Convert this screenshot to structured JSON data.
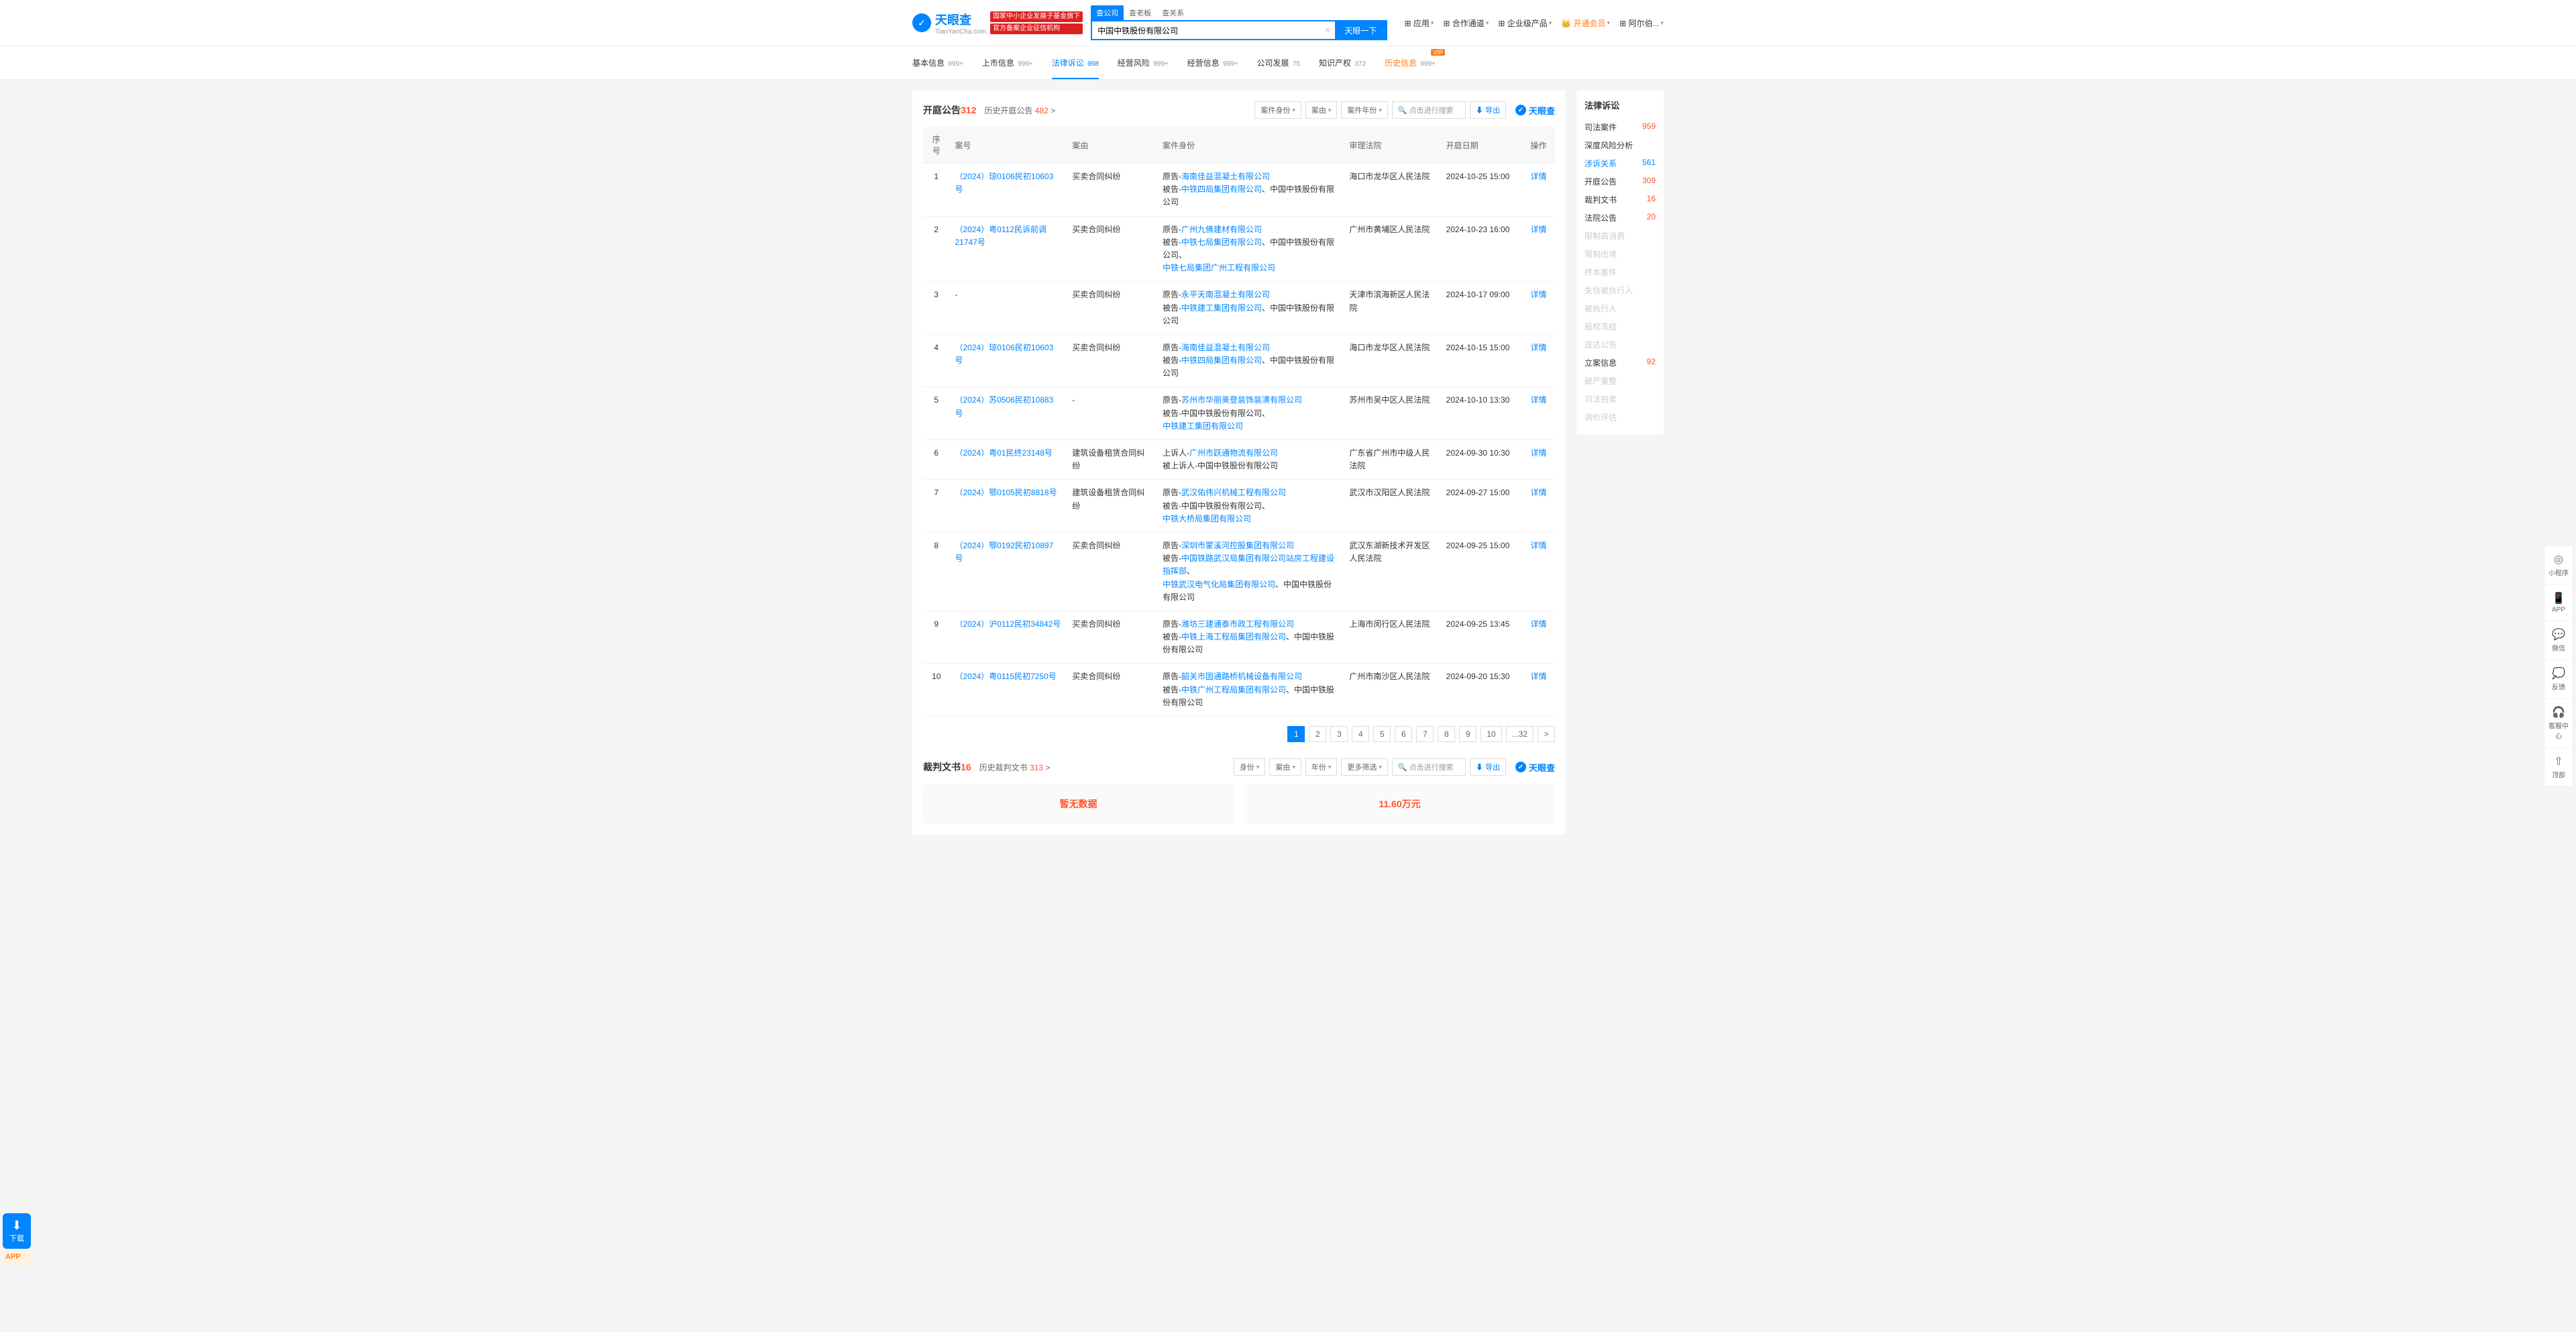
{
  "header": {
    "logo_text": "天眼查",
    "logo_sub": "TianYanCha.com",
    "badge1": "国家中小企业发展子基金旗下",
    "badge2": "官方备案企业征信机构",
    "search_tabs": [
      "查公司",
      "查老板",
      "查关系"
    ],
    "search_value": "中国中铁股份有限公司",
    "search_btn": "天眼一下",
    "nav": [
      {
        "label": "应用",
        "drop": true
      },
      {
        "label": "合作通道",
        "drop": true
      },
      {
        "label": "企业级产品",
        "drop": true
      },
      {
        "label": "开通会员",
        "vip": true,
        "drop": true
      },
      {
        "label": "阿尔伯...",
        "drop": true
      }
    ]
  },
  "cats": [
    {
      "label": "基本信息",
      "count": "999+"
    },
    {
      "label": "上市信息",
      "count": "999+"
    },
    {
      "label": "法律诉讼",
      "count": "998",
      "active": true
    },
    {
      "label": "经营风险",
      "count": "999+"
    },
    {
      "label": "经营信息",
      "count": "999+"
    },
    {
      "label": "公司发展",
      "count": "75"
    },
    {
      "label": "知识产权",
      "count": "372"
    },
    {
      "label": "历史信息",
      "count": "999+",
      "hist": true,
      "badge": "VIP"
    }
  ],
  "section": {
    "title": "开庭公告",
    "count": "312",
    "hist_label": "历史开庭公告",
    "hist_count": "482",
    "filters": [
      "案件身份",
      "案由",
      "案件年份"
    ],
    "search_ph": "点击进行搜索",
    "export": "导出",
    "brand": "天眼查"
  },
  "table": {
    "headers": [
      "序号",
      "案号",
      "案由",
      "案件身份",
      "审理法院",
      "开庭日期",
      "操作"
    ],
    "detail": "详情",
    "rows": [
      {
        "idx": "1",
        "case": "（2024）琼0106民初10603号",
        "reason": "买卖合同纠纷",
        "parties": [
          {
            "role": "原告",
            "name": "海南佳益混凝土有限公司",
            "link": true
          },
          {
            "role": "被告",
            "name": "中铁四局集团有限公司",
            "link": true,
            "tail": "、中国中铁股份有限公司"
          }
        ],
        "court": "海口市龙华区人民法院",
        "date": "2024-10-25 15:00"
      },
      {
        "idx": "2",
        "case": "（2024）粤0112民诉前调21747号",
        "reason": "买卖合同纠纷",
        "parties": [
          {
            "role": "原告",
            "name": "广州九佛建材有限公司",
            "link": true
          },
          {
            "role": "被告",
            "name": "中铁七局集团有限公司",
            "link": true,
            "tail": "、中国中铁股份有限公司、"
          },
          {
            "role": "",
            "name": "中铁七局集团广州工程有限公司",
            "link": true
          }
        ],
        "court": "广州市黄埔区人民法院",
        "date": "2024-10-23 16:00"
      },
      {
        "idx": "3",
        "case": "-",
        "case_link": false,
        "reason": "买卖合同纠纷",
        "parties": [
          {
            "role": "原告",
            "name": "永平天南混凝土有限公司",
            "link": true
          },
          {
            "role": "被告",
            "name": "中铁建工集团有限公司",
            "link": true,
            "tail": "、中国中铁股份有限公司"
          }
        ],
        "court": "天津市滨海新区人民法院",
        "date": "2024-10-17 09:00"
      },
      {
        "idx": "4",
        "case": "（2024）琼0106民初10603号",
        "reason": "买卖合同纠纷",
        "parties": [
          {
            "role": "原告",
            "name": "海南佳益混凝土有限公司",
            "link": true
          },
          {
            "role": "被告",
            "name": "中铁四局集团有限公司",
            "link": true,
            "tail": "、中国中铁股份有限公司"
          }
        ],
        "court": "海口市龙华区人民法院",
        "date": "2024-10-15 15:00"
      },
      {
        "idx": "5",
        "case": "（2024）苏0506民初10883号",
        "reason": "-",
        "parties": [
          {
            "role": "原告",
            "name": "苏州市华丽美登装饰装潢有限公司",
            "link": true
          },
          {
            "role": "被告",
            "name": "中国中铁股份有限公司、",
            "link": false
          },
          {
            "role": "",
            "name": "中铁建工集团有限公司",
            "link": true
          }
        ],
        "court": "苏州市吴中区人民法院",
        "date": "2024-10-10 13:30"
      },
      {
        "idx": "6",
        "case": "（2024）粤01民终23148号",
        "reason": "建筑设备租赁合同纠纷",
        "parties": [
          {
            "role": "上诉人",
            "name": "广州市跃通物流有限公司",
            "link": true
          },
          {
            "role": "被上诉人",
            "name": "中国中铁股份有限公司",
            "link": false
          }
        ],
        "court": "广东省广州市中级人民法院",
        "date": "2024-09-30 10:30"
      },
      {
        "idx": "7",
        "case": "（2024）鄂0105民初8818号",
        "reason": "建筑设备租赁合同纠纷",
        "parties": [
          {
            "role": "原告",
            "name": "武汉佑伟兴机械工程有限公司",
            "link": true
          },
          {
            "role": "被告",
            "name": "中国中铁股份有限公司、",
            "link": false
          },
          {
            "role": "",
            "name": "中铁大桥局集团有限公司",
            "link": true
          }
        ],
        "court": "武汉市汉阳区人民法院",
        "date": "2024-09-27 15:00"
      },
      {
        "idx": "8",
        "case": "（2024）鄂0192民初10897号",
        "reason": "买卖合同纠纷",
        "parties": [
          {
            "role": "原告",
            "name": "深圳市蒙溪河控股集团有限公司",
            "link": true
          },
          {
            "role": "被告",
            "name": "中国铁路武汉局集团有限公司站房工程建设指挥部",
            "link": true,
            "tail": "、"
          },
          {
            "role": "",
            "name": "中铁武汉电气化局集团有限公司",
            "link": true,
            "tail": "、中国中铁股份有限公司"
          }
        ],
        "court": "武汉东湖新技术开发区人民法院",
        "date": "2024-09-25 15:00"
      },
      {
        "idx": "9",
        "case": "（2024）沪0112民初34842号",
        "reason": "买卖合同纠纷",
        "parties": [
          {
            "role": "原告",
            "name": "潍坊三建通泰市政工程有限公司",
            "link": true
          },
          {
            "role": "被告",
            "name": "中铁上海工程局集团有限公司",
            "link": true,
            "tail": "、中国中铁股份有限公司"
          }
        ],
        "court": "上海市闵行区人民法院",
        "date": "2024-09-25 13:45"
      },
      {
        "idx": "10",
        "case": "（2024）粤0115民初7250号",
        "reason": "买卖合同纠纷",
        "parties": [
          {
            "role": "原告",
            "name": "韶关市固通路桥机械设备有限公司",
            "link": true
          },
          {
            "role": "被告",
            "name": "中铁广州工程局集团有限公司",
            "link": true,
            "tail": "、中国中铁股份有限公司"
          }
        ],
        "court": "广州市南沙区人民法院",
        "date": "2024-09-20 15:30"
      }
    ]
  },
  "pagination": [
    "1",
    "2",
    "3",
    "4",
    "5",
    "6",
    "7",
    "8",
    "9",
    "10",
    "...32",
    ">"
  ],
  "doc_section": {
    "title": "裁判文书",
    "count": "16",
    "hist_label": "历史裁判文书",
    "hist_count": "313",
    "filters": [
      "身份",
      "案由",
      "年份",
      "更多筛选"
    ],
    "nodata": "暂无数据",
    "amount": "11.60万元"
  },
  "sidebar": {
    "title": "法律诉讼",
    "items": [
      {
        "label": "司法案件",
        "count": "959"
      },
      {
        "label": "深度风险分析"
      },
      {
        "label": "涉诉关系",
        "count": "561",
        "active": true
      },
      {
        "label": "开庭公告",
        "count": "309"
      },
      {
        "label": "裁判文书",
        "count": "16"
      },
      {
        "label": "法院公告",
        "count": "20"
      },
      {
        "label": "限制高消费",
        "disabled": true
      },
      {
        "label": "限制出境",
        "disabled": true
      },
      {
        "label": "终本案件",
        "disabled": true
      },
      {
        "label": "失信被执行人",
        "disabled": true
      },
      {
        "label": "被执行人",
        "disabled": true
      },
      {
        "label": "股权冻结",
        "disabled": true
      },
      {
        "label": "送达公告",
        "disabled": true
      },
      {
        "label": "立案信息",
        "count": "92"
      },
      {
        "label": "破产重整",
        "disabled": true
      },
      {
        "label": "司法拍卖",
        "disabled": true
      },
      {
        "label": "询价评估",
        "disabled": true
      }
    ]
  },
  "float_left": {
    "label": "下载",
    "app": "APP"
  },
  "float_right": [
    {
      "icon": "◎",
      "label": "小程序"
    },
    {
      "icon": "📱",
      "label": "APP"
    },
    {
      "icon": "💬",
      "label": "微信"
    },
    {
      "icon": "💭",
      "label": "反馈"
    },
    {
      "icon": "🎧",
      "label": "客服中心"
    },
    {
      "icon": "⇧",
      "label": "顶部"
    }
  ]
}
